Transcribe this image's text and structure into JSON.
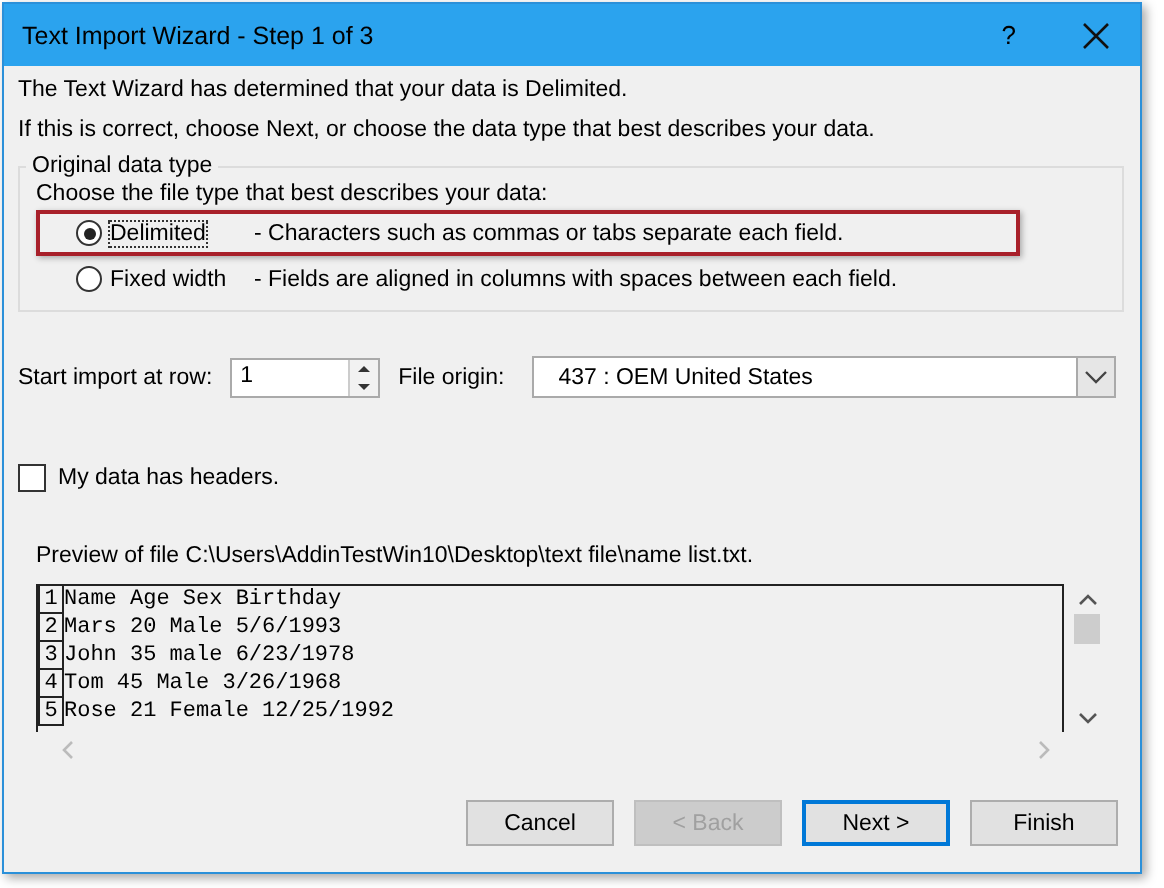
{
  "window": {
    "title": "Text Import Wizard - Step 1 of 3",
    "help": "?"
  },
  "intro": [
    "The Text Wizard has determined that your data is Delimited.",
    "If this is correct, choose Next, or choose the data type that best describes your data."
  ],
  "data_type_group": {
    "title": "Original data type",
    "prompt": "Choose the file type that best describes your data:",
    "options": [
      {
        "label": "Delimited",
        "description": "- Characters such as commas or tabs separate each field.",
        "selected": true,
        "highlighted": true
      },
      {
        "label": "Fixed width",
        "description": "- Fields are aligned in columns with spaces between each field.",
        "selected": false,
        "highlighted": false
      }
    ]
  },
  "start_row": {
    "label": "Start import at row:",
    "value": "1"
  },
  "file_origin": {
    "label": "File origin:",
    "value": "437 : OEM United States"
  },
  "headers_checkbox": {
    "label": "My data has headers.",
    "checked": false
  },
  "preview": {
    "caption": "Preview of file C:\\Users\\AddinTestWin10\\Desktop\\text file\\name list.txt.",
    "rows": [
      {
        "number": "1",
        "text": "Name Age Sex Birthday"
      },
      {
        "number": "2",
        "text": "Mars 20 Male 5/6/1993"
      },
      {
        "number": "3",
        "text": "John 35 male 6/23/1978"
      },
      {
        "number": "4",
        "text": "Tom 45 Male 3/26/1968"
      },
      {
        "number": "5",
        "text": "Rose 21 Female 12/25/1992"
      }
    ]
  },
  "buttons": [
    {
      "label": "Cancel",
      "default": false,
      "disabled": false
    },
    {
      "label": "< Back",
      "default": false,
      "disabled": true
    },
    {
      "label": "Next >",
      "default": true,
      "disabled": false
    },
    {
      "label": "Finish",
      "default": false,
      "disabled": false
    }
  ]
}
